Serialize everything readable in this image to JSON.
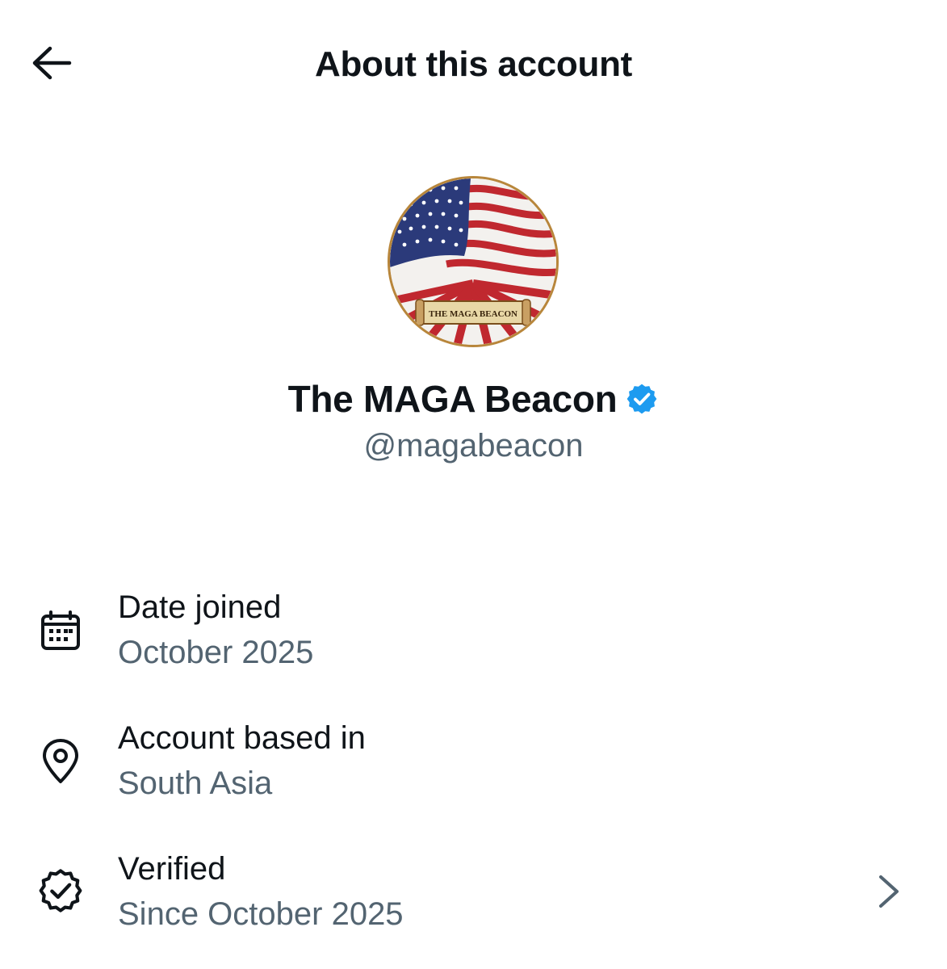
{
  "header": {
    "title": "About this account",
    "back_icon": "arrow-left-icon"
  },
  "profile": {
    "display_name": "The MAGA Beacon",
    "handle": "@magabeacon",
    "avatar_banner_text": "THE MAGA BEACON",
    "verified_color": "#1d9bf0"
  },
  "info": {
    "date_joined": {
      "label": "Date joined",
      "value": "October 2025",
      "icon": "calendar-icon"
    },
    "location": {
      "label": "Account based in",
      "value": "South Asia",
      "icon": "location-pin-icon"
    },
    "verified": {
      "label": "Verified",
      "value": "Since October 2025",
      "icon": "verified-check-icon",
      "chevron_icon": "chevron-right-icon"
    }
  },
  "colors": {
    "text_primary": "#0f1419",
    "text_secondary": "#536471",
    "accent": "#1d9bf0"
  }
}
